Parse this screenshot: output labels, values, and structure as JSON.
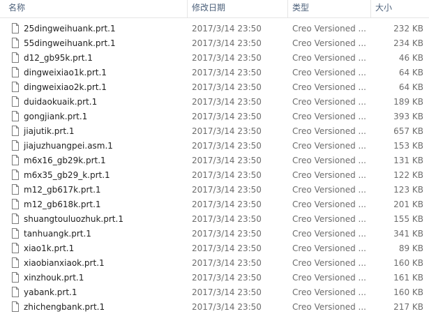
{
  "header": {
    "name_label": "名称",
    "date_label": "修改日期",
    "type_label": "类型",
    "size_label": "大小",
    "sort_indicator": "^"
  },
  "files": [
    {
      "name": "25dingweihuank.prt.1",
      "date": "2017/3/14 23:50",
      "type": "Creo Versioned ...",
      "size": "232 KB",
      "icon": "file-icon"
    },
    {
      "name": "55dingweihuank.prt.1",
      "date": "2017/3/14 23:50",
      "type": "Creo Versioned ...",
      "size": "234 KB",
      "icon": "file-icon"
    },
    {
      "name": "d12_gb95k.prt.1",
      "date": "2017/3/14 23:50",
      "type": "Creo Versioned ...",
      "size": "46 KB",
      "icon": "file-icon"
    },
    {
      "name": "dingweixiao1k.prt.1",
      "date": "2017/3/14 23:50",
      "type": "Creo Versioned ...",
      "size": "64 KB",
      "icon": "file-icon"
    },
    {
      "name": "dingweixiao2k.prt.1",
      "date": "2017/3/14 23:50",
      "type": "Creo Versioned ...",
      "size": "64 KB",
      "icon": "file-icon"
    },
    {
      "name": "duidaokuaik.prt.1",
      "date": "2017/3/14 23:50",
      "type": "Creo Versioned ...",
      "size": "189 KB",
      "icon": "file-icon"
    },
    {
      "name": "gongjiank.prt.1",
      "date": "2017/3/14 23:50",
      "type": "Creo Versioned ...",
      "size": "393 KB",
      "icon": "file-icon"
    },
    {
      "name": "jiajutik.prt.1",
      "date": "2017/3/14 23:50",
      "type": "Creo Versioned ...",
      "size": "657 KB",
      "icon": "file-icon"
    },
    {
      "name": "jiajuzhuangpei.asm.1",
      "date": "2017/3/14 23:50",
      "type": "Creo Versioned ...",
      "size": "153 KB",
      "icon": "file-icon"
    },
    {
      "name": "m6x16_gb29k.prt.1",
      "date": "2017/3/14 23:50",
      "type": "Creo Versioned ...",
      "size": "131 KB",
      "icon": "file-icon"
    },
    {
      "name": "m6x35_gb29_k.prt.1",
      "date": "2017/3/14 23:50",
      "type": "Creo Versioned ...",
      "size": "122 KB",
      "icon": "file-icon"
    },
    {
      "name": "m12_gb617k.prt.1",
      "date": "2017/3/14 23:50",
      "type": "Creo Versioned ...",
      "size": "123 KB",
      "icon": "file-icon"
    },
    {
      "name": "m12_gb618k.prt.1",
      "date": "2017/3/14 23:50",
      "type": "Creo Versioned ...",
      "size": "201 KB",
      "icon": "file-icon"
    },
    {
      "name": "shuangtouluozhuk.prt.1",
      "date": "2017/3/14 23:50",
      "type": "Creo Versioned ...",
      "size": "155 KB",
      "icon": "file-icon"
    },
    {
      "name": "tanhuangk.prt.1",
      "date": "2017/3/14 23:50",
      "type": "Creo Versioned ...",
      "size": "341 KB",
      "icon": "file-icon"
    },
    {
      "name": "xiao1k.prt.1",
      "date": "2017/3/14 23:50",
      "type": "Creo Versioned ...",
      "size": "89 KB",
      "icon": "file-icon"
    },
    {
      "name": "xiaobianxiaok.prt.1",
      "date": "2017/3/14 23:50",
      "type": "Creo Versioned ...",
      "size": "160 KB",
      "icon": "file-icon"
    },
    {
      "name": "xinzhouk.prt.1",
      "date": "2017/3/14 23:50",
      "type": "Creo Versioned ...",
      "size": "161 KB",
      "icon": "file-icon"
    },
    {
      "name": "yabank.prt.1",
      "date": "2017/3/14 23:50",
      "type": "Creo Versioned ...",
      "size": "160 KB",
      "icon": "file-icon"
    },
    {
      "name": "zhichengbank.prt.1",
      "date": "2017/3/14 23:50",
      "type": "Creo Versioned ...",
      "size": "217 KB",
      "icon": "file-icon"
    }
  ],
  "colors": {
    "header_text": "#4c607a",
    "name_text": "#1e1e1e",
    "meta_text": "#6d6d6d",
    "separator": "#e5e5e5"
  }
}
